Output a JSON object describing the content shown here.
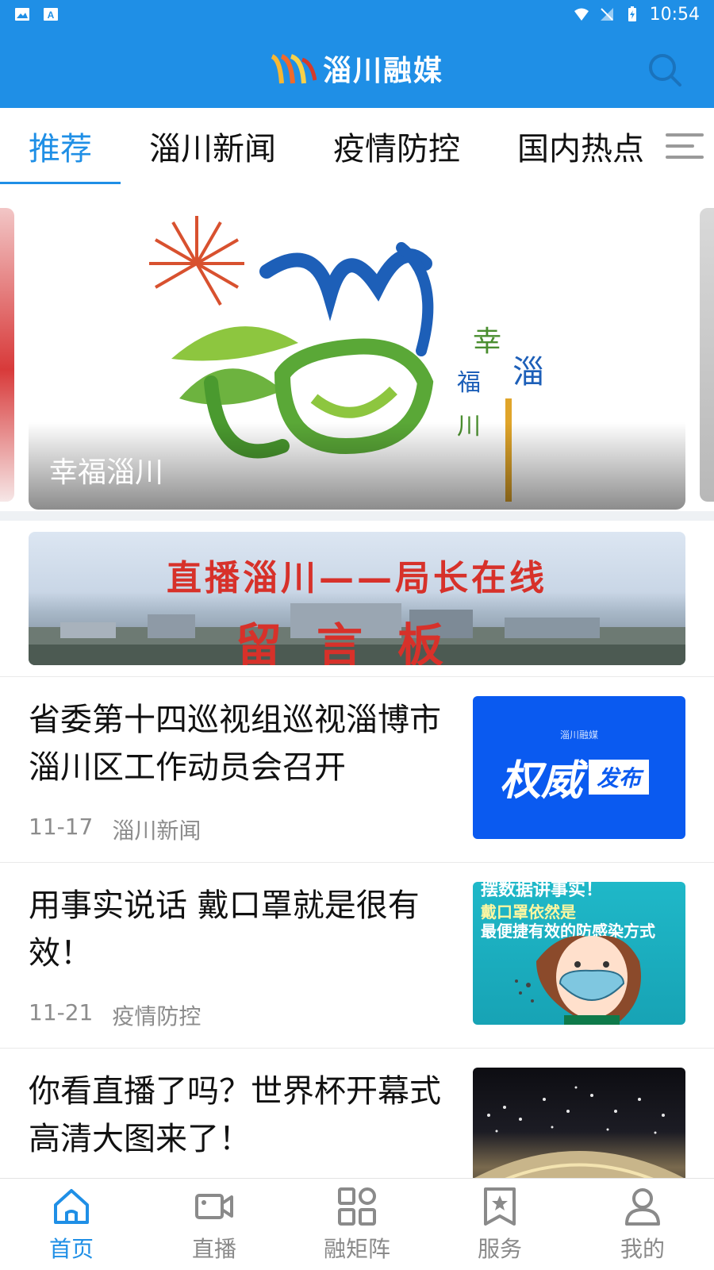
{
  "status_bar": {
    "time": "10:54",
    "left_icons": [
      "image-icon",
      "font-a-icon"
    ],
    "right_icons": [
      "wifi-icon",
      "no-signal-icon",
      "battery-charging-icon"
    ]
  },
  "header": {
    "app_title": "淄川融媒",
    "logo": "wave-logo",
    "search_icon": "search-icon"
  },
  "tabs": [
    {
      "label": "推荐",
      "active": true
    },
    {
      "label": "淄川新闻",
      "active": false
    },
    {
      "label": "疫情防控",
      "active": false
    },
    {
      "label": "国内热点",
      "active": false
    }
  ],
  "carousel": {
    "caption": "幸福淄川",
    "logo_side_text": "幸福淄川"
  },
  "banner": {
    "line1": "直播淄川——局长在线",
    "line2": "留言板"
  },
  "news": [
    {
      "title": "省委第十四巡视组巡视淄博市淄川区工作动员会召开",
      "date": "11-17",
      "category": "淄川新闻",
      "thumb": {
        "type": "authority",
        "small_brand": "淄川融媒",
        "big": "权威",
        "badge": "发布"
      }
    },
    {
      "title": "用事实说话 戴口罩就是很有效！",
      "date": "11-21",
      "category": "疫情防控",
      "thumb": {
        "type": "mask",
        "line1": "摆数据讲事实！",
        "line2": "戴口罩依然是",
        "line3": "最便捷有效的防感染方式"
      }
    },
    {
      "title": "你看直播了吗？世界杯开幕式高清大图来了！",
      "date": "",
      "category": "",
      "thumb": {
        "type": "fireworks"
      }
    }
  ],
  "bottom_nav": [
    {
      "label": "首页",
      "icon": "home-icon",
      "active": true
    },
    {
      "label": "直播",
      "icon": "video-camera-icon",
      "active": false
    },
    {
      "label": "融矩阵",
      "icon": "grid-icon",
      "active": false
    },
    {
      "label": "服务",
      "icon": "bookmark-star-icon",
      "active": false
    },
    {
      "label": "我的",
      "icon": "user-icon",
      "active": false
    }
  ],
  "colors": {
    "primary": "#1f8fe6",
    "text": "#111111",
    "meta": "#8c8c8c",
    "divider": "#eef1f4",
    "banner_red": "#d7312a"
  }
}
